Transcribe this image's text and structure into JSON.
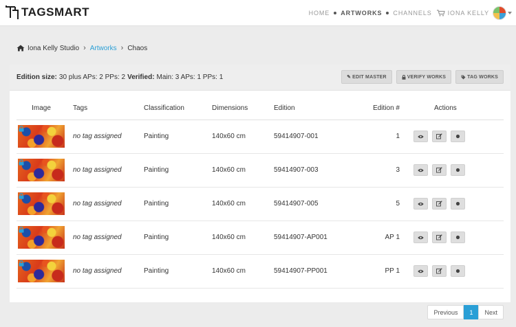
{
  "brand": {
    "name": "TAGSMART"
  },
  "nav": {
    "home": "HOME",
    "artworks": "ARTWORKS",
    "channels": "CHANNELS",
    "user": "IONA KELLY"
  },
  "breadcrumb": {
    "studio": "Iona Kelly Studio",
    "artworks": "Artworks",
    "current": "Chaos"
  },
  "info": {
    "edition_size_label": "Edition size:",
    "edition_size_value": "30 plus APs: 2 PPs: 2",
    "verified_label": "Verified:",
    "verified_value": "Main: 3 APs: 1 PPs: 1"
  },
  "buttons": {
    "edit_master": "EDIT MASTER",
    "verify_works": "VERIFY WORKS",
    "tag_works": "TAG WORKS"
  },
  "table": {
    "headers": [
      "Image",
      "Tags",
      "Classification",
      "Dimensions",
      "Edition",
      "Edition #",
      "Actions"
    ],
    "rows": [
      {
        "tags": "no tag assigned",
        "classification": "Painting",
        "dimensions": "140x60 cm",
        "edition": "59414907-001",
        "number": "1"
      },
      {
        "tags": "no tag assigned",
        "classification": "Painting",
        "dimensions": "140x60 cm",
        "edition": "59414907-003",
        "number": "3"
      },
      {
        "tags": "no tag assigned",
        "classification": "Painting",
        "dimensions": "140x60 cm",
        "edition": "59414907-005",
        "number": "5"
      },
      {
        "tags": "no tag assigned",
        "classification": "Painting",
        "dimensions": "140x60 cm",
        "edition": "59414907-AP001",
        "number": "AP 1"
      },
      {
        "tags": "no tag assigned",
        "classification": "Painting",
        "dimensions": "140x60 cm",
        "edition": "59414907-PP001",
        "number": "PP 1"
      }
    ]
  },
  "pagination": {
    "previous": "Previous",
    "current": "1",
    "next": "Next"
  },
  "colors": {
    "accent": "#2a9fd6",
    "background": "#ececec",
    "button": "#dcdcdc"
  },
  "icons": [
    "logo-icon",
    "cart-icon",
    "home-icon",
    "pencil-icon",
    "lock-icon",
    "tag-icon",
    "eye-icon",
    "edit-icon",
    "dot-icon"
  ]
}
